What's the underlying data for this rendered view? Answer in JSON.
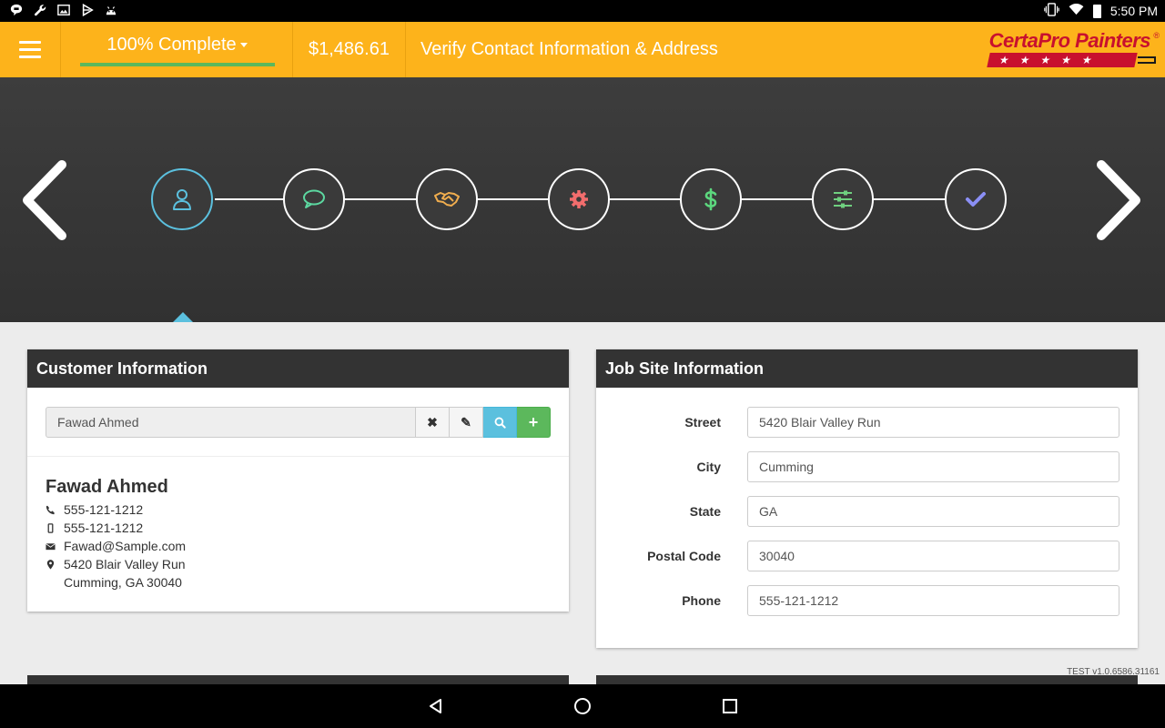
{
  "status_bar": {
    "left_icons": [
      "chat-bubble-icon",
      "wrench-icon",
      "image-icon",
      "play-store-icon",
      "android-icon"
    ],
    "right_icons": [
      "vibrate-icon",
      "wifi-icon",
      "battery-icon"
    ],
    "time": "5:50 PM"
  },
  "header": {
    "progress_label": "100% Complete",
    "progress_percent": 100,
    "price": "$1,486.61",
    "title": "Verify Contact Information & Address",
    "logo_text": "CertaPro Painters",
    "logo_reg": "®",
    "logo_stars": "★★★★★"
  },
  "wizard": {
    "steps": [
      {
        "icon": "user-icon",
        "color": "#5bc0de",
        "active": true
      },
      {
        "icon": "comment-icon",
        "color": "#5cd7a0",
        "active": false
      },
      {
        "icon": "handshake-icon",
        "color": "#f0ad4e",
        "active": false
      },
      {
        "icon": "gear-icon",
        "color": "#f26d6d",
        "active": false
      },
      {
        "icon": "dollar-icon",
        "color": "#5cd77e",
        "active": false
      },
      {
        "icon": "sliders-icon",
        "color": "#6fd07f",
        "active": false
      },
      {
        "icon": "check-icon",
        "color": "#8b8ff5",
        "active": false
      }
    ]
  },
  "customer_panel": {
    "title": "Customer Information",
    "search_value": "Fawad Ahmed",
    "buttons": {
      "clear": "✖",
      "edit": "✎",
      "search": "search-icon",
      "add": "+"
    },
    "name": "Fawad Ahmed",
    "phone": "555-121-1212",
    "mobile": "555-121-1212",
    "email": "Fawad@Sample.com",
    "address_line1": "5420 Blair Valley Run",
    "address_line2": "Cumming, GA 30040"
  },
  "job_panel": {
    "title": "Job Site Information",
    "fields": [
      {
        "label": "Street",
        "value": "5420 Blair Valley Run"
      },
      {
        "label": "City",
        "value": "Cumming"
      },
      {
        "label": "State",
        "value": "GA"
      },
      {
        "label": "Postal Code",
        "value": "30040"
      },
      {
        "label": "Phone",
        "value": "555-121-1212"
      }
    ]
  },
  "version": "TEST v1.0.6586.31161",
  "nav_bar": [
    "back-icon",
    "home-icon",
    "recents-icon"
  ]
}
